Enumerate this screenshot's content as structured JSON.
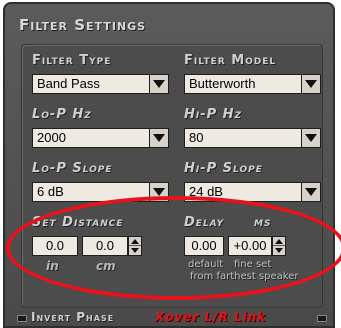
{
  "panel": {
    "title": "Filter Settings"
  },
  "filter_type": {
    "label": "Filter Type",
    "value": "Band Pass"
  },
  "filter_model": {
    "label": "Filter Model",
    "value": "Butterworth"
  },
  "lo_p_hz": {
    "label": "Lo-P  Hz",
    "value": "2000"
  },
  "hi_p_hz": {
    "label": "Hi-P  Hz",
    "value": "80"
  },
  "lo_p_slope": {
    "label": "Lo-P Slope",
    "value": "6 dB"
  },
  "hi_p_slope": {
    "label": "Hi-P Slope",
    "value": "24 dB"
  },
  "set_distance": {
    "label": "Set Distance",
    "inches": "0.0",
    "cm": "0.0",
    "unit_in": "in",
    "unit_cm": "cm"
  },
  "delay": {
    "label": "Delay",
    "unit": "ms",
    "default_value": "0.00",
    "fine_value": "+0.00",
    "default_caption": "default",
    "fine_caption": "fine set",
    "note": "from farthest speaker"
  },
  "bottom": {
    "invert_phase": "Invert Phase",
    "xover_link": "Xover L/R Link"
  },
  "colors": {
    "highlight": "#e8121c",
    "panel": "#4c4c4c",
    "field": "#eeeae2"
  }
}
